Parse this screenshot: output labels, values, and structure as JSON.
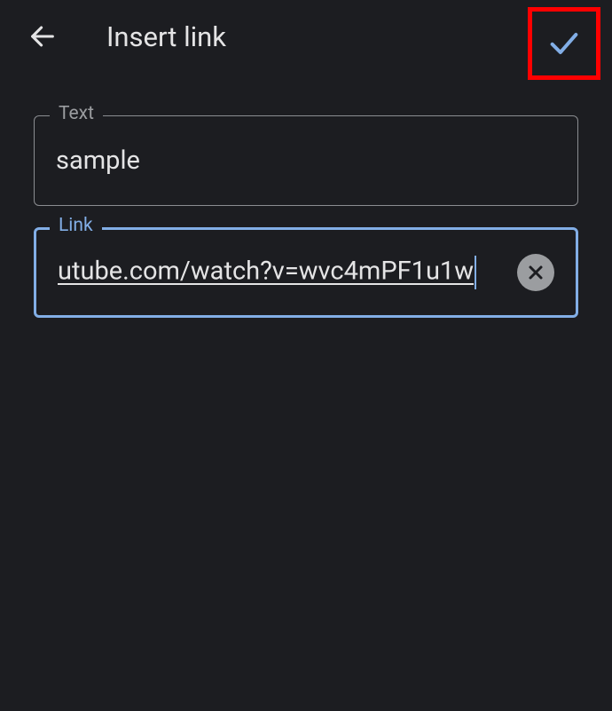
{
  "header": {
    "title": "Insert link"
  },
  "fields": {
    "text": {
      "label": "Text",
      "value": "sample"
    },
    "link": {
      "label": "Link",
      "value": "utube.com/watch?v=wvc4mPF1u1w"
    }
  }
}
